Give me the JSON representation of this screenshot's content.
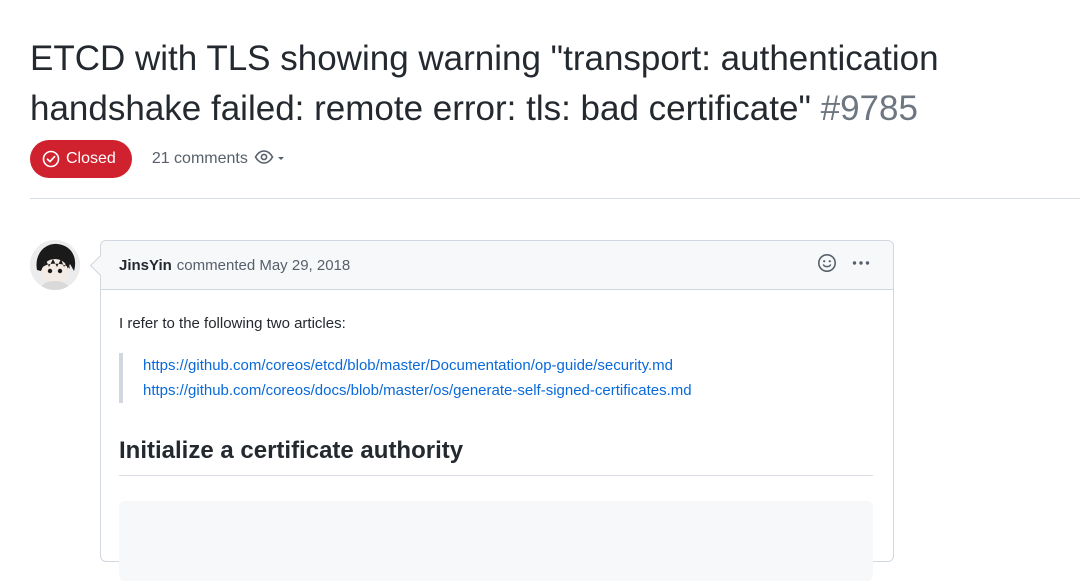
{
  "issue": {
    "title": "ETCD with TLS showing warning \"transport: authentication handshake failed: remote error: tls: bad certificate\"",
    "number": "#9785",
    "state": "Closed",
    "comments_count": "21 comments"
  },
  "comment": {
    "author": "JinsYin",
    "action": "commented",
    "date": "May 29, 2018",
    "intro": "I refer to the following two articles:",
    "links": [
      "https://github.com/coreos/etcd/blob/master/Documentation/op-guide/security.md",
      "https://github.com/coreos/docs/blob/master/os/generate-self-signed-certificates.md"
    ],
    "heading": "Initialize a certificate authority"
  },
  "icons": {
    "state": "issue-closed-icon",
    "watch": "eye-icon",
    "dropdown": "caret-down-icon",
    "reaction": "smiley-icon",
    "more": "kebab-horizontal-icon"
  },
  "colors": {
    "closed": "#cf222e",
    "link": "#0969da",
    "muted": "#57606a"
  }
}
